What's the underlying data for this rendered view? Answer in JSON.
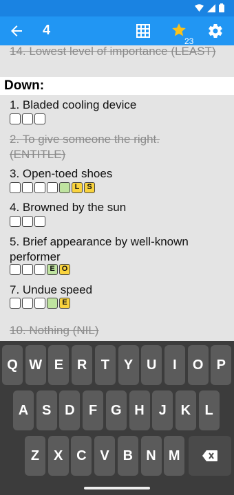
{
  "app_bar": {
    "current_clue_number": "4",
    "star_count": "23"
  },
  "clues": {
    "across_partial": "14. Lowest level of importance (LEAST)",
    "down_header": "Down:",
    "down": [
      {
        "label": "1. Bladed cooling device",
        "solved": false,
        "boxes": [
          {
            "letter": "",
            "state": "empty"
          },
          {
            "letter": "",
            "state": "empty"
          },
          {
            "letter": "",
            "state": "empty"
          }
        ]
      },
      {
        "label": "2. To give someone the right. (ENTITLE)",
        "solved": true
      },
      {
        "label": "3. Open-toed shoes",
        "solved": false,
        "boxes": [
          {
            "letter": "",
            "state": "empty"
          },
          {
            "letter": "",
            "state": "empty"
          },
          {
            "letter": "",
            "state": "empty"
          },
          {
            "letter": "",
            "state": "empty"
          },
          {
            "letter": "",
            "state": "green"
          },
          {
            "letter": "L",
            "state": "yellow"
          },
          {
            "letter": "S",
            "state": "yellow"
          }
        ]
      },
      {
        "label": "4. Browned by the sun",
        "solved": false,
        "boxes": [
          {
            "letter": "",
            "state": "empty"
          },
          {
            "letter": "",
            "state": "empty"
          },
          {
            "letter": "",
            "state": "empty"
          }
        ]
      },
      {
        "label": "5. Brief appearance by well-known performer",
        "solved": false,
        "boxes": [
          {
            "letter": "",
            "state": "empty"
          },
          {
            "letter": "",
            "state": "empty"
          },
          {
            "letter": "",
            "state": "empty"
          },
          {
            "letter": "E",
            "state": "green"
          },
          {
            "letter": "O",
            "state": "yellow"
          }
        ]
      },
      {
        "label": "7. Undue speed",
        "solved": false,
        "boxes": [
          {
            "letter": "",
            "state": "empty"
          },
          {
            "letter": "",
            "state": "empty"
          },
          {
            "letter": "",
            "state": "empty"
          },
          {
            "letter": "",
            "state": "green"
          },
          {
            "letter": "E",
            "state": "yellow"
          }
        ]
      },
      {
        "label": "10. Nothing (NIL)",
        "solved": true
      }
    ]
  },
  "keyboard": {
    "row1": [
      "Q",
      "W",
      "E",
      "R",
      "T",
      "Y",
      "U",
      "I",
      "O",
      "P"
    ],
    "row2": [
      "A",
      "S",
      "D",
      "F",
      "G",
      "H",
      "J",
      "K",
      "L"
    ],
    "row3": [
      "Z",
      "X",
      "C",
      "V",
      "B",
      "N",
      "M"
    ],
    "backspace_icon": "backspace-icon"
  },
  "colors": {
    "app_bar": "#2196f3",
    "status_bar": "#1a83e2",
    "box_green": "#bfe3a0",
    "box_yellow": "#f9d33e",
    "keyboard_bg": "#3c3c3c"
  }
}
